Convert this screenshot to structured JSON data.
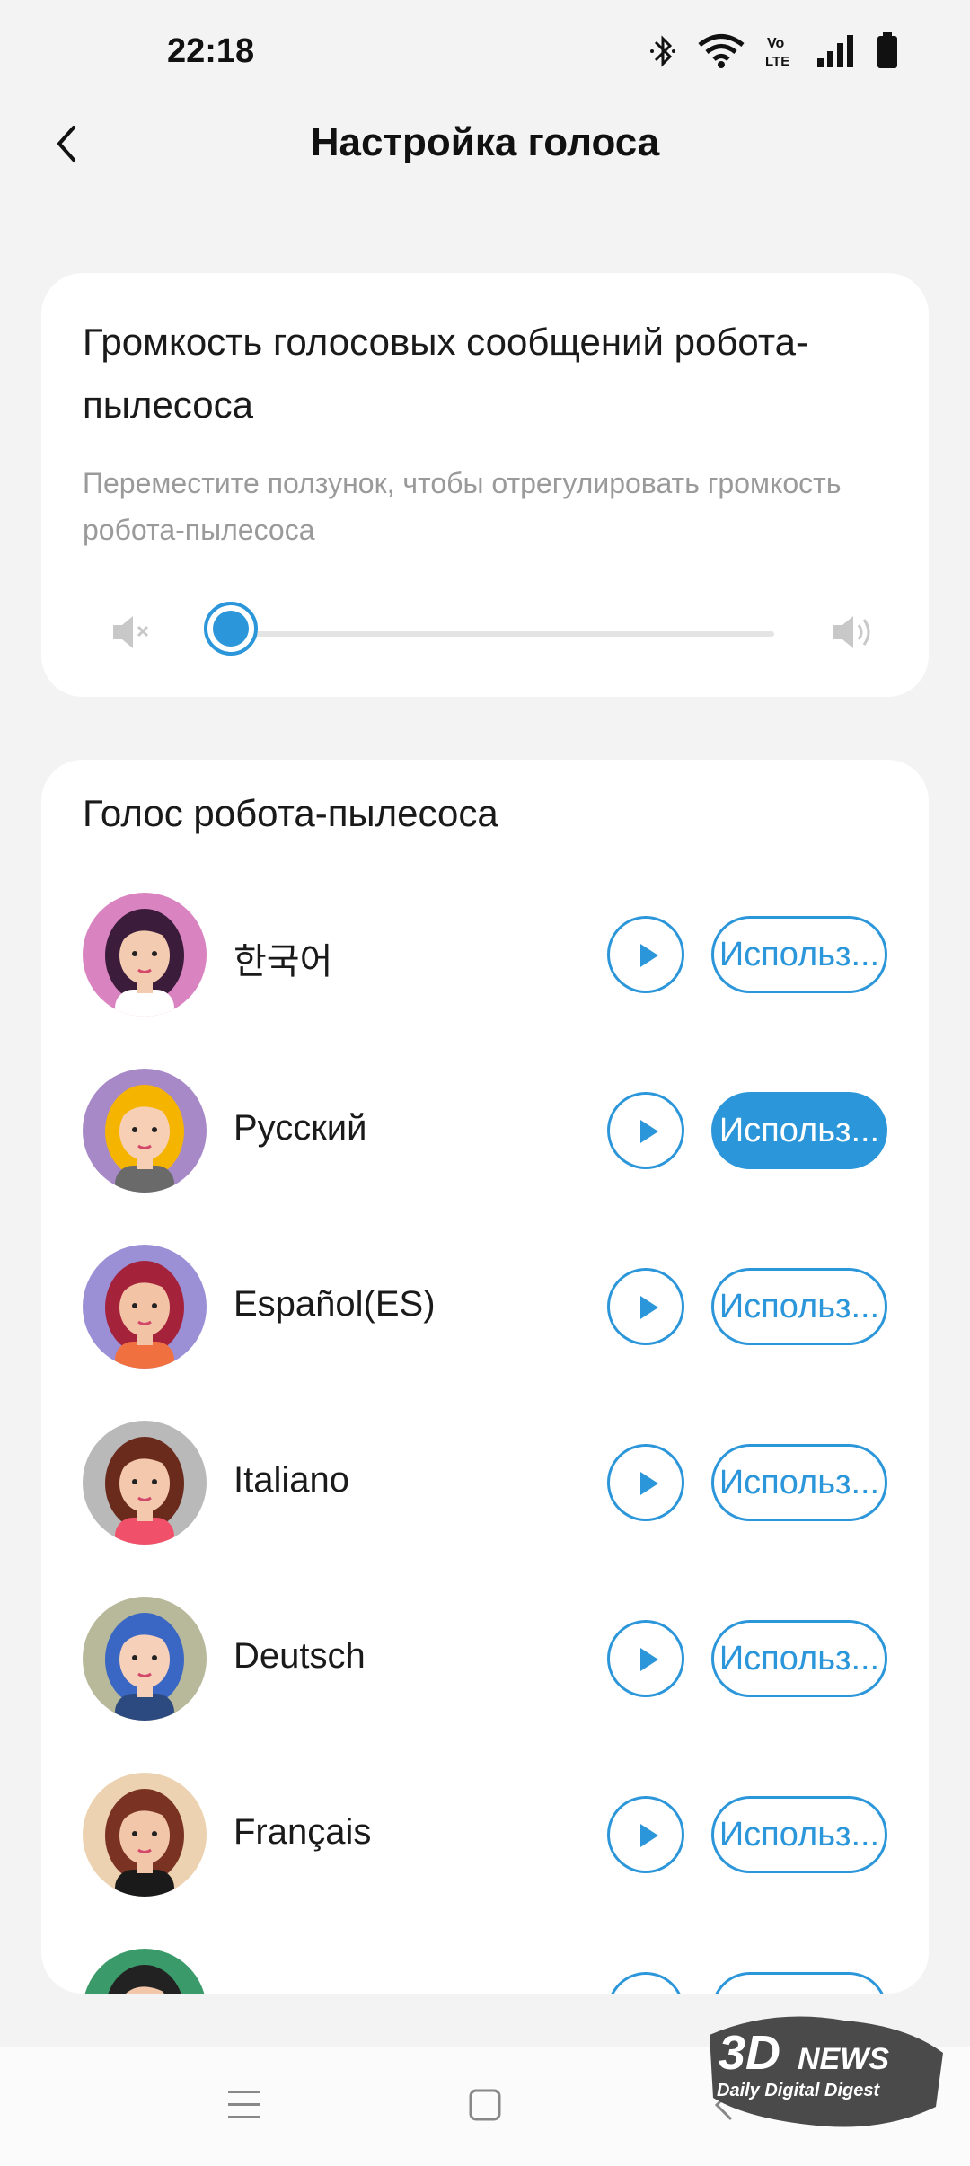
{
  "status_bar": {
    "time": "22:18",
    "icons": [
      "bluetooth-icon",
      "wifi-icon",
      "volte-icon",
      "signal-icon",
      "battery-icon"
    ],
    "volte_label": "Vo\nLTE"
  },
  "header": {
    "back_icon": "chevron-left-icon",
    "title": "Настройка голоса"
  },
  "volume_card": {
    "title": "Громкость голосовых сообщений робота-пылесоса",
    "description": "Переместите ползунок, чтобы отрегулировать громкость робота-пылесоса",
    "slider_value": 0,
    "min_icon": "volume-mute-icon",
    "max_icon": "volume-high-icon"
  },
  "voice_card": {
    "title": "Голос робота-пылесоса",
    "items": [
      {
        "label": "한국어",
        "use_label": "Использ...",
        "active": false
      },
      {
        "label": "Русский",
        "use_label": "Использ...",
        "active": true
      },
      {
        "label": "Español(ES)",
        "use_label": "Использ...",
        "active": false
      },
      {
        "label": "Italiano",
        "use_label": "Использ...",
        "active": false
      },
      {
        "label": "Deutsch",
        "use_label": "Использ...",
        "active": false
      },
      {
        "label": "Français",
        "use_label": "Использ...",
        "active": false
      },
      {
        "label": "",
        "use_label": "",
        "active": false
      }
    ]
  },
  "watermark": {
    "brand": "3DNEWS",
    "tagline": "Daily Digital Digest"
  },
  "colors": {
    "accent": "#2b96d9",
    "background": "#f3f3f3",
    "card": "#ffffff"
  }
}
